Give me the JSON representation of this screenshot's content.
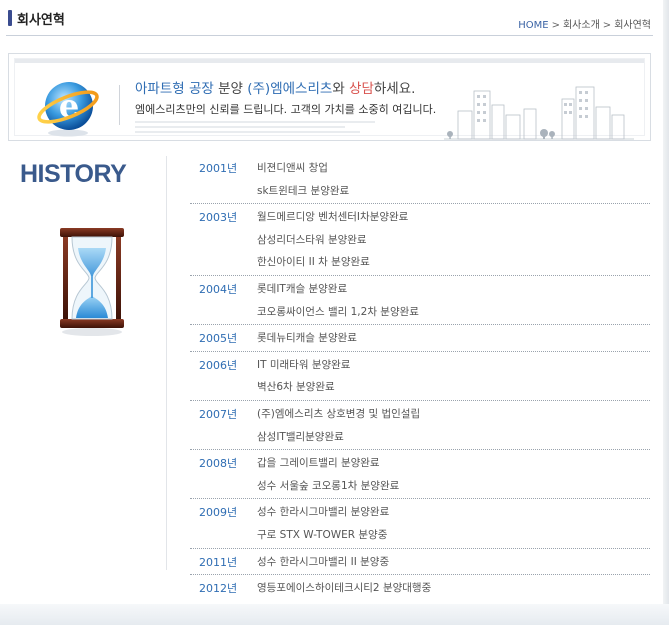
{
  "header": {
    "title": "회사연혁",
    "breadcrumb": [
      "HOME",
      "회사소개",
      "회사연혁"
    ],
    "separator": ">"
  },
  "banner": {
    "line1_part1": "아파트형 공장",
    "line1_part2": " 분양 ",
    "line1_part3": "(주)엠에스리츠",
    "line1_part4": "와 ",
    "line1_part5": "상담",
    "line1_part6": "하세요.",
    "line2": "엠에스리츠만의 신뢰를 드립니다. 고객의 가치를 소중히 여깁니다.",
    "logo_icon": "ie-e-logo-icon",
    "illustration": "city-buildings-illustration"
  },
  "history": {
    "title": "HISTORY",
    "image": "hourglass-icon",
    "years": [
      {
        "year": "2001년",
        "events": [
          "비젼디앤씨 창업",
          "sk트윈테크 분양완료"
        ]
      },
      {
        "year": "2003년",
        "events": [
          "월드메르디앙 벤처센터I차분양완료",
          "삼성리더스타워 분양완료",
          "한신아이티 II 차 분양완료"
        ]
      },
      {
        "year": "2004년",
        "events": [
          "롯데IT캐슬 분양완료",
          "코오롱싸이언스 밸리 1,2차 분양완료"
        ]
      },
      {
        "year": "2005년",
        "events": [
          "롯데뉴티캐슬 분양완료"
        ]
      },
      {
        "year": "2006년",
        "events": [
          "IT 미래타워 분양완료",
          "벽산6차 분양완료"
        ]
      },
      {
        "year": "2007년",
        "events": [
          "(주)엠에스리츠 상호변경 및 법인설립",
          "삼성IT밸리분양완료"
        ]
      },
      {
        "year": "2008년",
        "events": [
          "갑을 그레이트밸리 분양완료",
          "성수 서울숲 코오롱1차 분양완료"
        ]
      },
      {
        "year": "2009년",
        "events": [
          "성수 한라시그마밸리 분양완료",
          "구로 STX W-TOWER 분양중"
        ]
      },
      {
        "year": "2011년",
        "events": [
          "성수 한라시그마밸리 II 분양중"
        ]
      },
      {
        "year": "2012년",
        "events": [
          "영등포에이스하이테크시티2 분양대행중"
        ]
      }
    ]
  },
  "colors": {
    "accent_blue": "#2f6db3",
    "title_blue": "#3a5a8c",
    "highlight_red": "#d9534f"
  }
}
